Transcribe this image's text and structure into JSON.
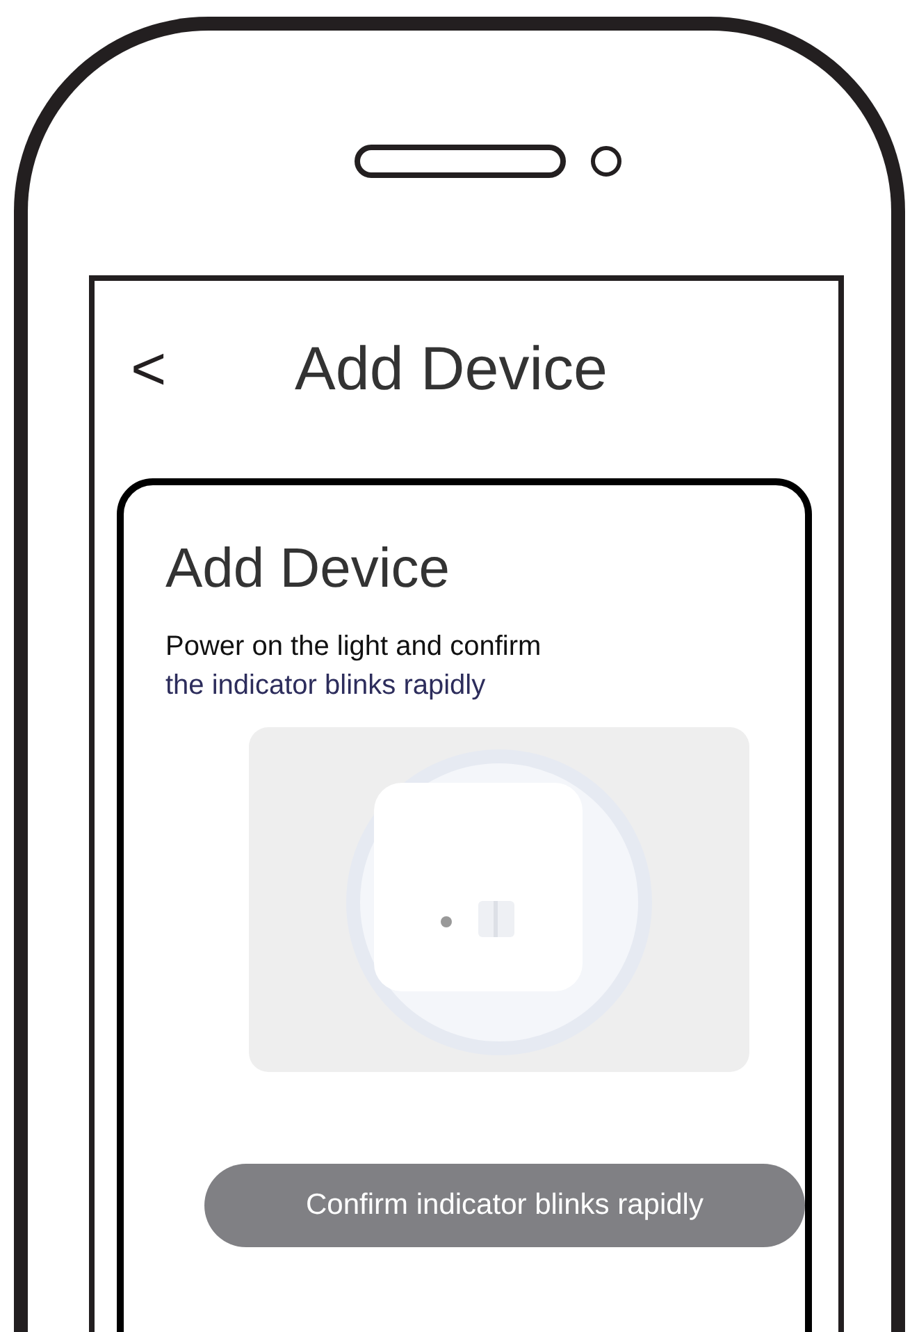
{
  "header": {
    "back": "<",
    "title": "Add Device"
  },
  "card": {
    "title": "Add Device",
    "instruction": "Power on the light and confirm",
    "instruction_highlight": "the indicator blinks rapidly",
    "button": {
      "label": "Confirm indicator blinks rapidly",
      "disabled": true
    }
  }
}
